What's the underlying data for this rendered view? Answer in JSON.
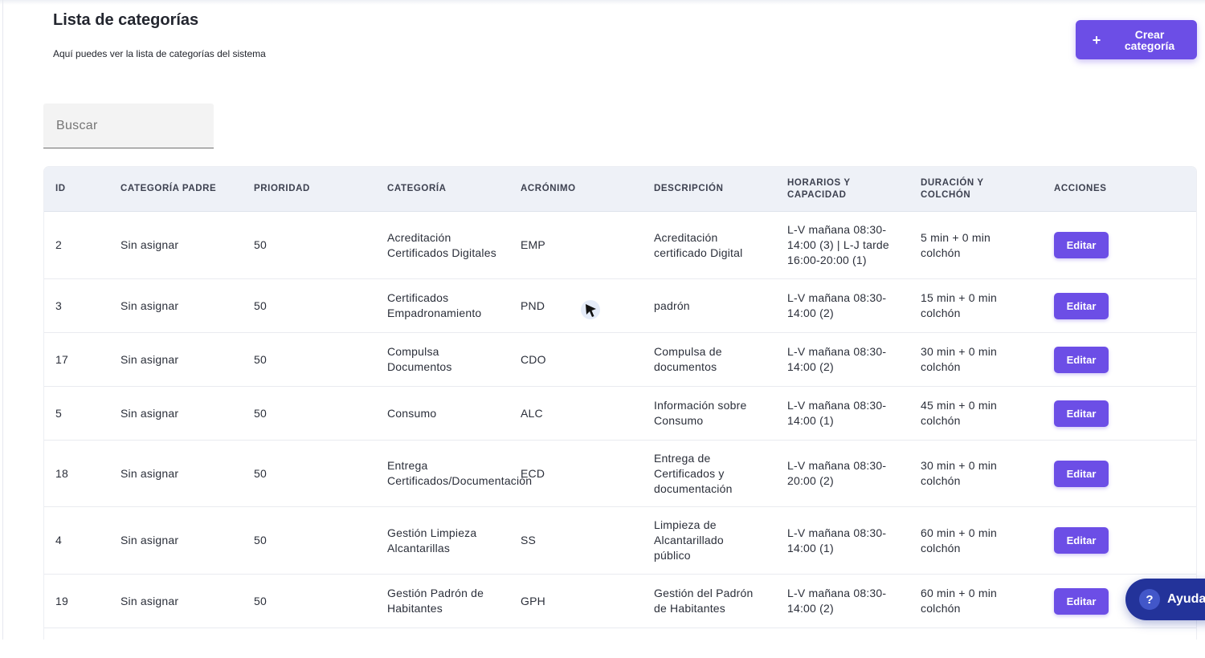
{
  "header": {
    "title": "Lista de categorías",
    "subtitle": "Aquí puedes ver la lista de categorías del sistema",
    "create_plus": "+",
    "create_label": "Crear categoría"
  },
  "search": {
    "placeholder": "Buscar",
    "value": ""
  },
  "table": {
    "columns": {
      "id": "ID",
      "parent": "CATEGORÍA PADRE",
      "priority": "PRIORIDAD",
      "category": "CATEGORÍA",
      "acronym": "ACRÓNIMO",
      "description": "DESCRIPCIÓN",
      "schedule": "HORARIOS Y CAPACIDAD",
      "duration": "DURACIÓN Y COLCHÓN",
      "actions": "ACCIONES"
    },
    "rows": [
      {
        "id": "2",
        "parent": "Sin asignar",
        "priority": "50",
        "category": "Acreditación Certificados Digitales",
        "acronym": "EMP",
        "description": "Acreditación certificado Digital",
        "schedule": "L-V mañana 08:30-14:00 (3) | L-J tarde 16:00-20:00 (1)",
        "duration": "5 min + 0 min colchón",
        "action": "Editar"
      },
      {
        "id": "3",
        "parent": "Sin asignar",
        "priority": "50",
        "category": "Certificados Empadronamiento",
        "acronym": "PND",
        "description": "padrón",
        "schedule": "L-V mañana 08:30-14:00 (2)",
        "duration": "15 min + 0 min colchón",
        "action": "Editar"
      },
      {
        "id": "17",
        "parent": "Sin asignar",
        "priority": "50",
        "category": "Compulsa Documentos",
        "acronym": "CDO",
        "description": "Compulsa de documentos",
        "schedule": "L-V mañana 08:30-14:00 (2)",
        "duration": "30 min + 0 min colchón",
        "action": "Editar"
      },
      {
        "id": "5",
        "parent": "Sin asignar",
        "priority": "50",
        "category": "Consumo",
        "acronym": "ALC",
        "description": "Información sobre Consumo",
        "schedule": "L-V mañana 08:30-14:00 (1)",
        "duration": "45 min + 0 min colchón",
        "action": "Editar"
      },
      {
        "id": "18",
        "parent": "Sin asignar",
        "priority": "50",
        "category": "Entrega Certificados/Documentación",
        "acronym": "ECD",
        "description": "Entrega de Certificados y documentación",
        "schedule": "L-V mañana 08:30-20:00 (2)",
        "duration": "30 min + 0 min colchón",
        "action": "Editar"
      },
      {
        "id": "4",
        "parent": "Sin asignar",
        "priority": "50",
        "category": "Gestión Limpieza Alcantarillas",
        "acronym": "SS",
        "description": "Limpieza de Alcantarillado público",
        "schedule": "L-V mañana 08:30-14:00 (1)",
        "duration": "60 min + 0 min colchón",
        "action": "Editar"
      },
      {
        "id": "19",
        "parent": "Sin asignar",
        "priority": "50",
        "category": "Gestión Padrón de Habitantes",
        "acronym": "GPH",
        "description": "Gestión del Padrón de Habitantes",
        "schedule": "L-V mañana 08:30-14:00 (2)",
        "duration": "60 min + 0 min colchón",
        "action": "Editar"
      }
    ]
  },
  "help": {
    "icon": "?",
    "label": "Ayuda"
  },
  "colors": {
    "accent": "#6c4ee6",
    "help": "#23339a",
    "header_bg": "#eef1f7"
  }
}
